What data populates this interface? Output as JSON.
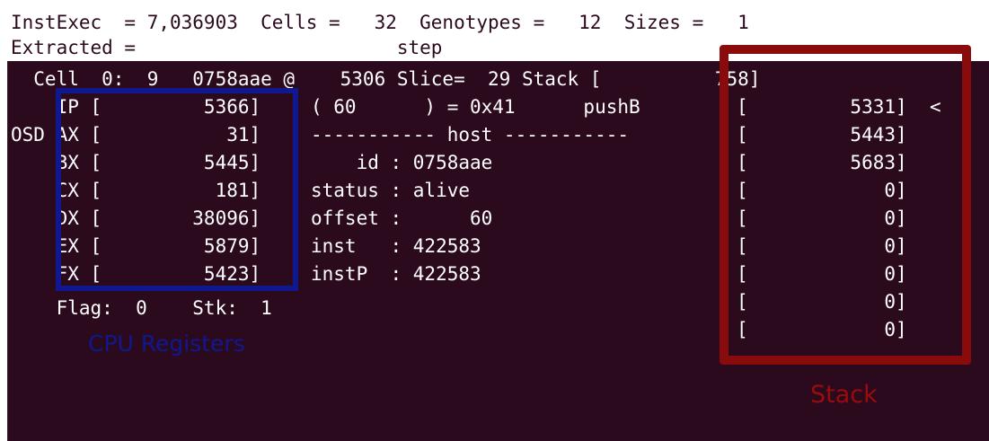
{
  "header": {
    "line1": "InstExec  = 7,036903  Cells =   32  Genotypes =   12  Sizes =   1",
    "line2": "Extracted =                       step"
  },
  "cell_line": "  Cell  0:  9   0758aae @    5306 Slice=  29 Stack [          758]",
  "registers": [
    {
      "prefix": "    ",
      "name": "IP",
      "value": "5366"
    },
    {
      "prefix": "OSD ",
      "name": "AX",
      "value": "31"
    },
    {
      "prefix": "    ",
      "name": "BX",
      "value": "5445"
    },
    {
      "prefix": "    ",
      "name": "CX",
      "value": "181"
    },
    {
      "prefix": "    ",
      "name": "DX",
      "value": "38096"
    },
    {
      "prefix": "    ",
      "name": "EX",
      "value": "5879"
    },
    {
      "prefix": "    ",
      "name": "FX",
      "value": "5423"
    }
  ],
  "middle_lines": [
    "( 60      ) = 0x41      pushB  ",
    "----------- host -----------",
    "    id : 0758aae",
    "status : alive",
    "offset :      60",
    "inst   : 422583",
    "instP  : 422583"
  ],
  "stack_values": [
    "5331",
    "5443",
    "5683",
    "0",
    "0",
    "0",
    "0",
    "0",
    "0"
  ],
  "stack_pointer_marker": "<",
  "flag_line": "    Flag:  0    Stk:  1",
  "annotations": {
    "cpu_registers_label": "CPU Registers",
    "stack_label": "Stack"
  },
  "colors": {
    "terminal_bg": "#2c0a1e",
    "registers_box": "#10188f",
    "stack_box": "#8a0b0b"
  }
}
